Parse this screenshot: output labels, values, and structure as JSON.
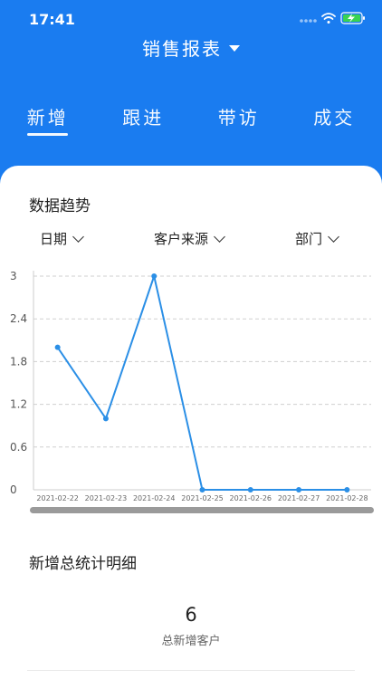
{
  "status_bar": {
    "time": "17:41"
  },
  "header": {
    "title": "销售报表"
  },
  "tabs": [
    {
      "label": "新增",
      "active": true
    },
    {
      "label": "跟进",
      "active": false
    },
    {
      "label": "带访",
      "active": false
    },
    {
      "label": "成交",
      "active": false
    }
  ],
  "trend": {
    "title": "数据趋势",
    "filters": [
      {
        "label": "日期"
      },
      {
        "label": "客户来源"
      },
      {
        "label": "部门"
      }
    ]
  },
  "chart_data": {
    "type": "line",
    "title": "",
    "xlabel": "",
    "ylabel": "",
    "x": [
      "2021-02-22",
      "2021-02-23",
      "2021-02-24",
      "2021-02-25",
      "2021-02-26",
      "2021-02-27",
      "2021-02-28"
    ],
    "y_ticks": [
      "0",
      "0.6",
      "1.2",
      "1.8",
      "2.4",
      "3"
    ],
    "series": [
      {
        "values": [
          2,
          1,
          3,
          0,
          0,
          0,
          0
        ]
      }
    ],
    "ylim": [
      0,
      3
    ],
    "grid": true,
    "color": "#2b8fe6"
  },
  "detail": {
    "title": "新增总统计明细",
    "total_value": "6",
    "total_label": "总新增客户"
  },
  "colors": {
    "primary": "#1a7cf0"
  }
}
